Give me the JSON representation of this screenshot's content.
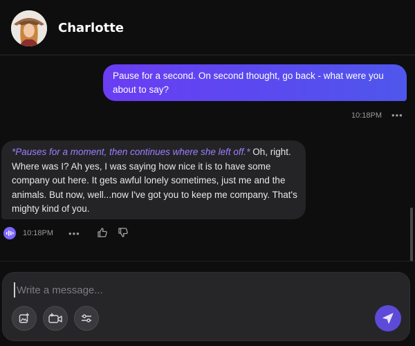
{
  "header": {
    "name": "Charlotte"
  },
  "messages": {
    "user": {
      "text": "Pause for a second. On second thought, go back - what were you about to say?",
      "time": "10:18PM",
      "more": "•••"
    },
    "bot": {
      "narration": "*Pauses for a moment, then continues where she left off.*",
      "text": " Oh, right. Where was I? Ah yes, I was saying how nice it is to have some company out here. It gets awful lonely sometimes, just me and the animals. But now, well...now I've got you to keep me company. That's mighty kind of you.",
      "time": "10:18PM",
      "more": "•••"
    }
  },
  "composer": {
    "placeholder": "Write a message...",
    "value": ""
  },
  "colors": {
    "accent": "#5d4ad8",
    "narration": "#9d7fff",
    "user_bubble_start": "#6a3df3",
    "user_bubble_end": "#4f56ec"
  },
  "icons": {
    "avatar": "avatar-image",
    "voice": "voice-wave-icon",
    "like": "thumbs-up-icon",
    "dislike": "thumbs-down-icon",
    "image": "image-plus-icon",
    "video": "video-plus-icon",
    "settings": "sliders-icon",
    "send": "send-icon"
  }
}
